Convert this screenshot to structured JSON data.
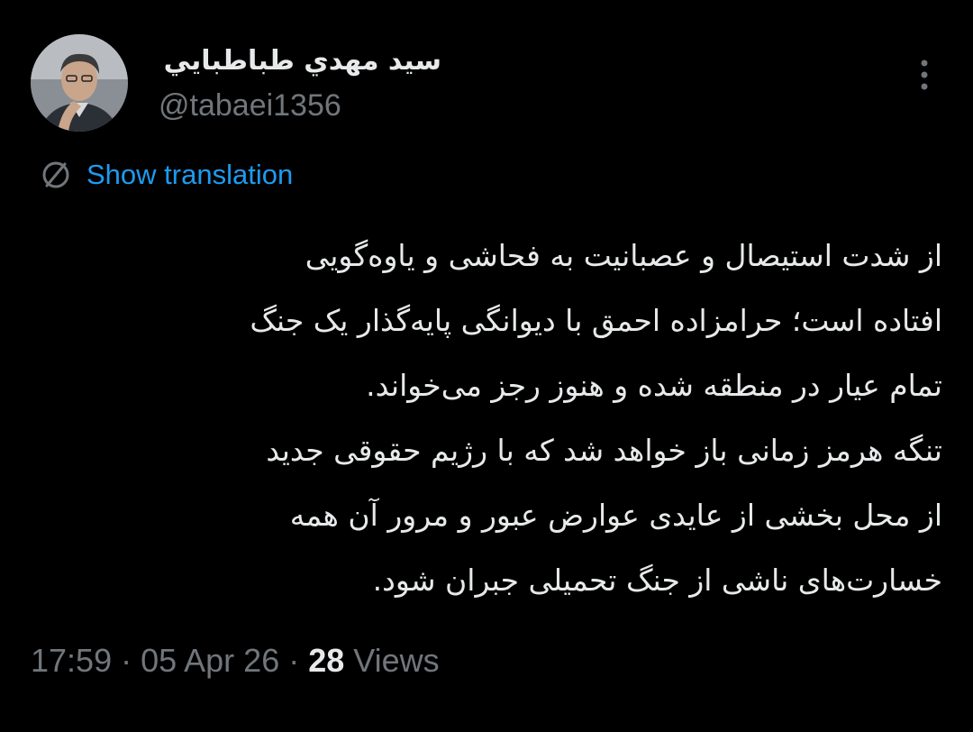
{
  "author": {
    "display_name": "سيد مهدي طباطبايي",
    "handle": "@tabaei1356"
  },
  "actions": {
    "more_icon": "more-vertical-icon",
    "show_translation": "Show translation",
    "translate_icon": "globe-icon"
  },
  "tweet": {
    "lines": [
      "از شدت استیصال و عصبانیت به فحاشی و یاوه‌گویی",
      "افتاده است؛ حرامزاده احمق با دیوانگی پایه‌گذار یک جنگ",
      "تمام عیار در منطقه شده و هنوز رجز می‌خواند.",
      "تنگه هرمز زمانی باز خواهد شد که با رژیم حقوقی جدید",
      "از محل بخشی از عایدی عوارض عبور و مرور آن همه",
      "خسارت‌های ناشی از جنگ تحمیلی جبران شود."
    ]
  },
  "meta": {
    "time": "17:59",
    "separator": "·",
    "date": "05 Apr 26",
    "views_count": "28",
    "views_label": "Views"
  },
  "colors": {
    "background": "#000000",
    "text": "#e7e9ea",
    "secondary": "#71767b",
    "accent": "#1d9bf0"
  }
}
